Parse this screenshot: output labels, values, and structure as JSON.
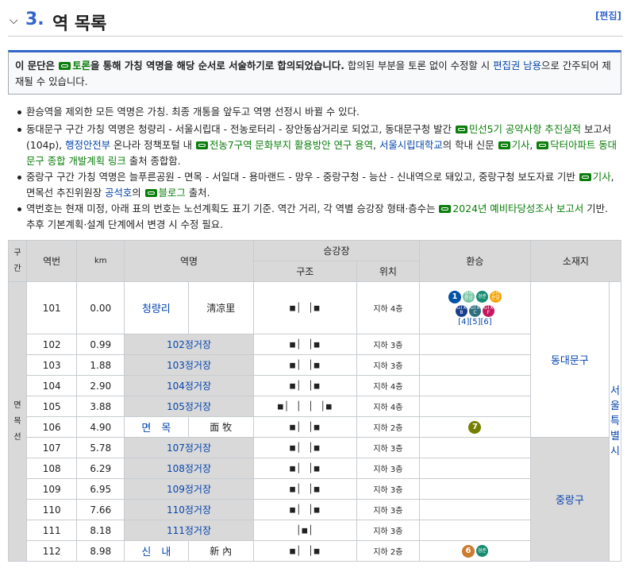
{
  "heading": {
    "number": "3.",
    "title": "역 목록",
    "edit": "[편집]"
  },
  "notice": {
    "b1": "이 문단은 ",
    "link": "토론",
    "b2": "을 통해 가칭 역명을 해당 순서로 서술하기로 합의되었습니다.",
    "t1": " 합의된 부분을 토론 없이 수정할 시 ",
    "link2": "편집권 남용",
    "t2": "으로 간주되어 제재될 수 있습니다."
  },
  "bullets": {
    "b1": "환승역을 제외한 모든 역명은 가칭. 최종 개통을 앞두고 역명 선정시 바뀔 수 있다.",
    "b2a": "동대문구 구간 가칭 역명은 청량리 - 서울시립대 - 전농로터리 - 장안동삼거리로 되었고, 동대문구청 발간 ",
    "b2l1": "민선5기 공약사항 추진실적",
    "b2b": " 보고서(104p), ",
    "b2l2": "행정안전부",
    "b2c": " 온나라 정책포털 내 ",
    "b2l3": "전농7구역 문화부지 활용방안 연구 용역",
    "b2d": ", ",
    "b2l4": "서울시립대학교",
    "b2e": "의 학내 신문 ",
    "b2l5": "기사",
    "b2f": ", ",
    "b2l6": "닥터아파트 동대문구 종합 개발계획 링크",
    "b2g": " 출처 종합함.",
    "b3a": "중랑구 구간 가칭 역명은 늘푸른공원 - 면목 - 서일대 - 용마랜드 - 망우 - 중랑구청 - 능산 - 신내역으로 돼있고, 중랑구청 보도자료 기반 ",
    "b3l1": "기사",
    "b3b": ", 면목선 추진위원장 ",
    "b3l2": "공석호",
    "b3c": "의 ",
    "b3l3": "블로그",
    "b3d": " 출처.",
    "b4a": "역번호는 현재 미정, 아래 표의 번호는 노선계획도 표기 기준. 역간 거리, 각 역별 승강장 형태·층수는 ",
    "b4l1": "2024년 예비타당성조사 보고서",
    "b4b": " 기반. 추후 기본계획·설계 단계에서 변경 시 수정 필요."
  },
  "table": {
    "headers": {
      "section": "구\n간",
      "num": "역번",
      "km": "km",
      "name": "역명",
      "platform": "승강장",
      "structure": "구조",
      "position": "위치",
      "transfer": "환승",
      "location": "소재지"
    },
    "section_label": "면\n목\n선",
    "districts": {
      "d1": "동대문구",
      "d2": "중랑구",
      "city": "서\n울\n특\n별\n시"
    },
    "rows": [
      {
        "num": "101",
        "km": "0.00",
        "name": "청량리",
        "hanja": "淸凉里",
        "plat": "■│ │■",
        "pos": "지하 4층"
      },
      {
        "num": "102",
        "km": "0.99",
        "name": "102정거장",
        "plat": "■│ │■",
        "pos": "지하 3층"
      },
      {
        "num": "103",
        "km": "1.88",
        "name": "103정거장",
        "plat": "■│ │■",
        "pos": "지하 3층"
      },
      {
        "num": "104",
        "km": "2.90",
        "name": "104정거장",
        "plat": "■│ │■",
        "pos": "지하 4층"
      },
      {
        "num": "105",
        "km": "3.88",
        "name": "105정거장",
        "plat": "■│ │ │ │■",
        "pos": "지하 4층"
      },
      {
        "num": "106",
        "km": "4.90",
        "name": "면　목",
        "hanja": "面 牧",
        "plat": "■│ │■",
        "pos": "지하 2층"
      },
      {
        "num": "107",
        "km": "5.78",
        "name": "107정거장",
        "plat": "■│ │■",
        "pos": "지하 3층"
      },
      {
        "num": "108",
        "km": "6.29",
        "name": "108정거장",
        "plat": "■│ │■",
        "pos": "지하 3층"
      },
      {
        "num": "109",
        "km": "6.95",
        "name": "109정거장",
        "plat": "■│ │■",
        "pos": "지하 3층"
      },
      {
        "num": "110",
        "km": "7.66",
        "name": "110정거장",
        "plat": "■│ │■",
        "pos": "지하 3층"
      },
      {
        "num": "111",
        "km": "8.18",
        "name": "111정거장",
        "plat": "│■│",
        "pos": "지하 3층"
      },
      {
        "num": "112",
        "km": "8.98",
        "name": "신　내",
        "hanja": "新 內",
        "plat": "■│ │■",
        "pos": "지하 2층"
      }
    ],
    "transfers": {
      "r101": {
        "l1": "1",
        "gyeongui": "경의\n중앙",
        "gyeongchun": "경춘",
        "suin": "수인\n분당",
        "gtx_a": "GTX\nB",
        "gtx_b": "GTX\nC",
        "gtx_c": "GTX\nF",
        "refs": "[4][5][6]"
      },
      "r106": "7",
      "r112": {
        "l6": "6",
        "gc": "경춘"
      }
    },
    "colors": {
      "line1": "#0052a4",
      "line6": "#cd7c2f",
      "line7": "#747f00",
      "gyeongui": "#77c4a3",
      "gyeongchun": "#178c72",
      "suin": "#f5a200",
      "gtx_b": "#1a3e8e",
      "gtx_c": "#2f6e7e",
      "gtx_f": "#c8175e"
    }
  }
}
